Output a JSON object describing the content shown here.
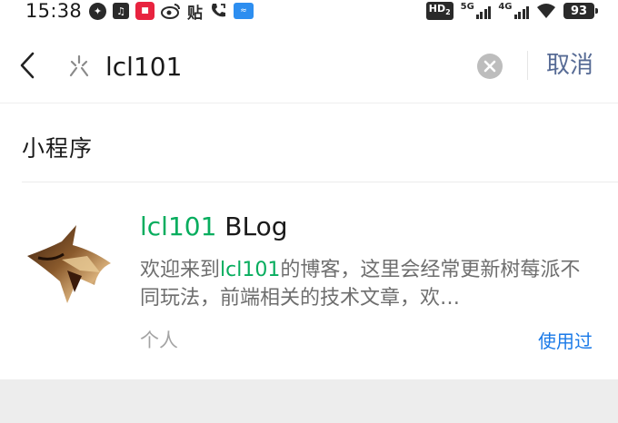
{
  "status_bar": {
    "time": "15:38",
    "icons_left": [
      "compass-icon",
      "tiktok-icon",
      "taobao-icon",
      "weibo-icon",
      "tieba-icon",
      "call-icon",
      "app-icon"
    ],
    "tieba_label": "贴",
    "hd_label": "HD",
    "hd_sub": "2",
    "net1_label": "5G",
    "net2_label": "4G",
    "battery": "93"
  },
  "search": {
    "query": "lcl101",
    "cancel_label": "取消"
  },
  "results": {
    "section_title": "小程序",
    "item": {
      "name_highlight": "lcl101",
      "name_rest": " BLog",
      "desc_before": "欢迎来到",
      "desc_highlight": "lcl101",
      "desc_after": "的博客，这里会经常更新树莓派不同玩法，前端相关的技术文章，欢…",
      "type": "个人",
      "badge": "使用过"
    }
  },
  "colors": {
    "accent_green": "#07ad5e",
    "link_blue": "#1a7ae8",
    "cancel_blue": "#576b95"
  }
}
